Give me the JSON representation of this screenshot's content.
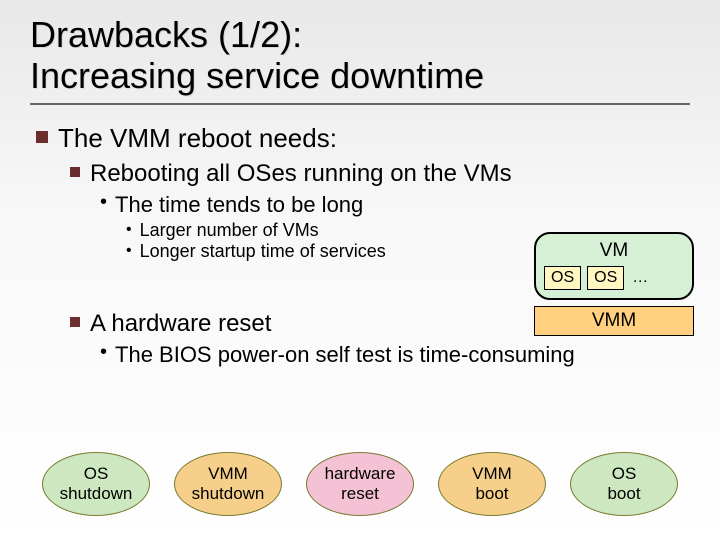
{
  "title": "Drawbacks (1/2):\nIncreasing service downtime",
  "bullets": {
    "l1": "The VMM reboot needs:",
    "l2a": "Rebooting all OSes running on the VMs",
    "l3a": "The time tends to be long",
    "l4a": "Larger number of VMs",
    "l4b": "Longer startup time of services",
    "l2b": "A hardware reset",
    "l3b": "The BIOS power-on self test is time-consuming"
  },
  "diagram": {
    "vm_label": "VM",
    "os_label": "OS",
    "ellipsis": "…",
    "vmm_label": "VMM"
  },
  "flow": {
    "s1": "OS\nshutdown",
    "s2": "VMM\nshutdown",
    "s3": "hardware\nreset",
    "s4": "VMM\nboot",
    "s5": "OS\nboot"
  }
}
